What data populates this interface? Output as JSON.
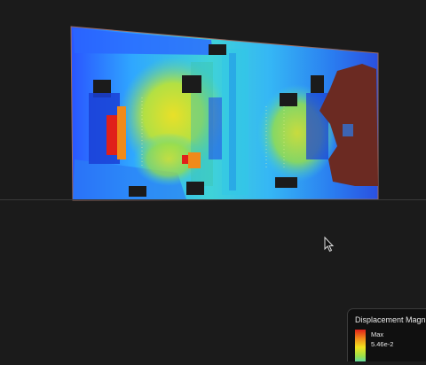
{
  "legend": {
    "title": "Displacement Magnitu",
    "max_label": "Max",
    "max_value": "5.46e-2"
  },
  "colors": {
    "background": "#1b1b1b",
    "max": "#e0201a",
    "mid": "#f2e21e",
    "low": "#2c7bff",
    "min": "#1a3fd6",
    "fixed_region": "#6b2a22"
  },
  "icons": {
    "cursor": "mouse-pointer-icon"
  }
}
